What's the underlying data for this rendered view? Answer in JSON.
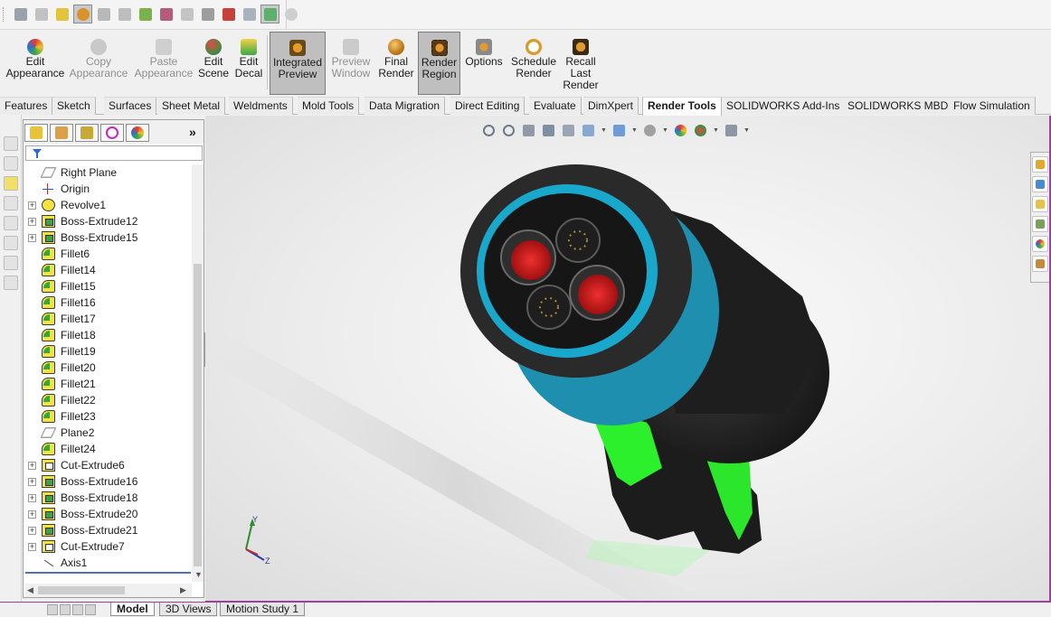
{
  "ribbon": {
    "edit_appearance": "Edit\nAppearance",
    "copy_appearance": "Copy\nAppearance",
    "paste_appearance": "Paste\nAppearance",
    "edit_scene": "Edit\nScene",
    "edit_decal": "Edit\nDecal",
    "integrated_preview": "Integrated\nPreview",
    "preview_window": "Preview\nWindow",
    "final_render": "Final\nRender",
    "render_region": "Render\nRegion",
    "options": "Options",
    "schedule_render": "Schedule\nRender",
    "recall_last_render": "Recall\nLast\nRender"
  },
  "tabs": [
    "Features",
    "Sketch",
    "Surfaces",
    "Sheet Metal",
    "Weldments",
    "Mold Tools",
    "Data Migration",
    "Direct Editing",
    "Evaluate",
    "DimXpert",
    "Render Tools",
    "SOLIDWORKS Add-Ins",
    "SOLIDWORKS MBD",
    "Flow Simulation"
  ],
  "active_tab": "Render Tools",
  "feature_tree": [
    {
      "label": "Right Plane",
      "type": "plane",
      "expandable": false
    },
    {
      "label": "Origin",
      "type": "origin",
      "expandable": false
    },
    {
      "label": "Revolve1",
      "type": "revolve",
      "expandable": true
    },
    {
      "label": "Boss-Extrude12",
      "type": "boss",
      "expandable": true
    },
    {
      "label": "Boss-Extrude15",
      "type": "boss",
      "expandable": true
    },
    {
      "label": "Fillet6",
      "type": "fillet",
      "expandable": false
    },
    {
      "label": "Fillet14",
      "type": "fillet",
      "expandable": false
    },
    {
      "label": "Fillet15",
      "type": "fillet",
      "expandable": false
    },
    {
      "label": "Fillet16",
      "type": "fillet",
      "expandable": false
    },
    {
      "label": "Fillet17",
      "type": "fillet",
      "expandable": false
    },
    {
      "label": "Fillet18",
      "type": "fillet",
      "expandable": false
    },
    {
      "label": "Fillet19",
      "type": "fillet",
      "expandable": false
    },
    {
      "label": "Fillet20",
      "type": "fillet",
      "expandable": false
    },
    {
      "label": "Fillet21",
      "type": "fillet",
      "expandable": false
    },
    {
      "label": "Fillet22",
      "type": "fillet",
      "expandable": false
    },
    {
      "label": "Fillet23",
      "type": "fillet",
      "expandable": false
    },
    {
      "label": "Plane2",
      "type": "plane",
      "expandable": false
    },
    {
      "label": "Fillet24",
      "type": "fillet",
      "expandable": false
    },
    {
      "label": "Cut-Extrude6",
      "type": "cut",
      "expandable": true
    },
    {
      "label": "Boss-Extrude16",
      "type": "boss",
      "expandable": true
    },
    {
      "label": "Boss-Extrude18",
      "type": "boss",
      "expandable": true
    },
    {
      "label": "Boss-Extrude20",
      "type": "boss",
      "expandable": true
    },
    {
      "label": "Boss-Extrude21",
      "type": "boss",
      "expandable": true
    },
    {
      "label": "Cut-Extrude7",
      "type": "cut",
      "expandable": true
    },
    {
      "label": "Axis1",
      "type": "axis",
      "expandable": false
    }
  ],
  "triad": {
    "y": "Y",
    "x": "X",
    "z": "Z"
  },
  "bottom_tabs": [
    "Model",
    "3D Views",
    "Motion Study 1"
  ],
  "active_bottom_tab": "Model",
  "colors": {
    "housing": "#2a2a2a",
    "collar": "#1f8fb0",
    "handle_insert": "#2cf02c",
    "pin_red": "#d61e1e",
    "viewport_border": "#9b3fa0"
  }
}
